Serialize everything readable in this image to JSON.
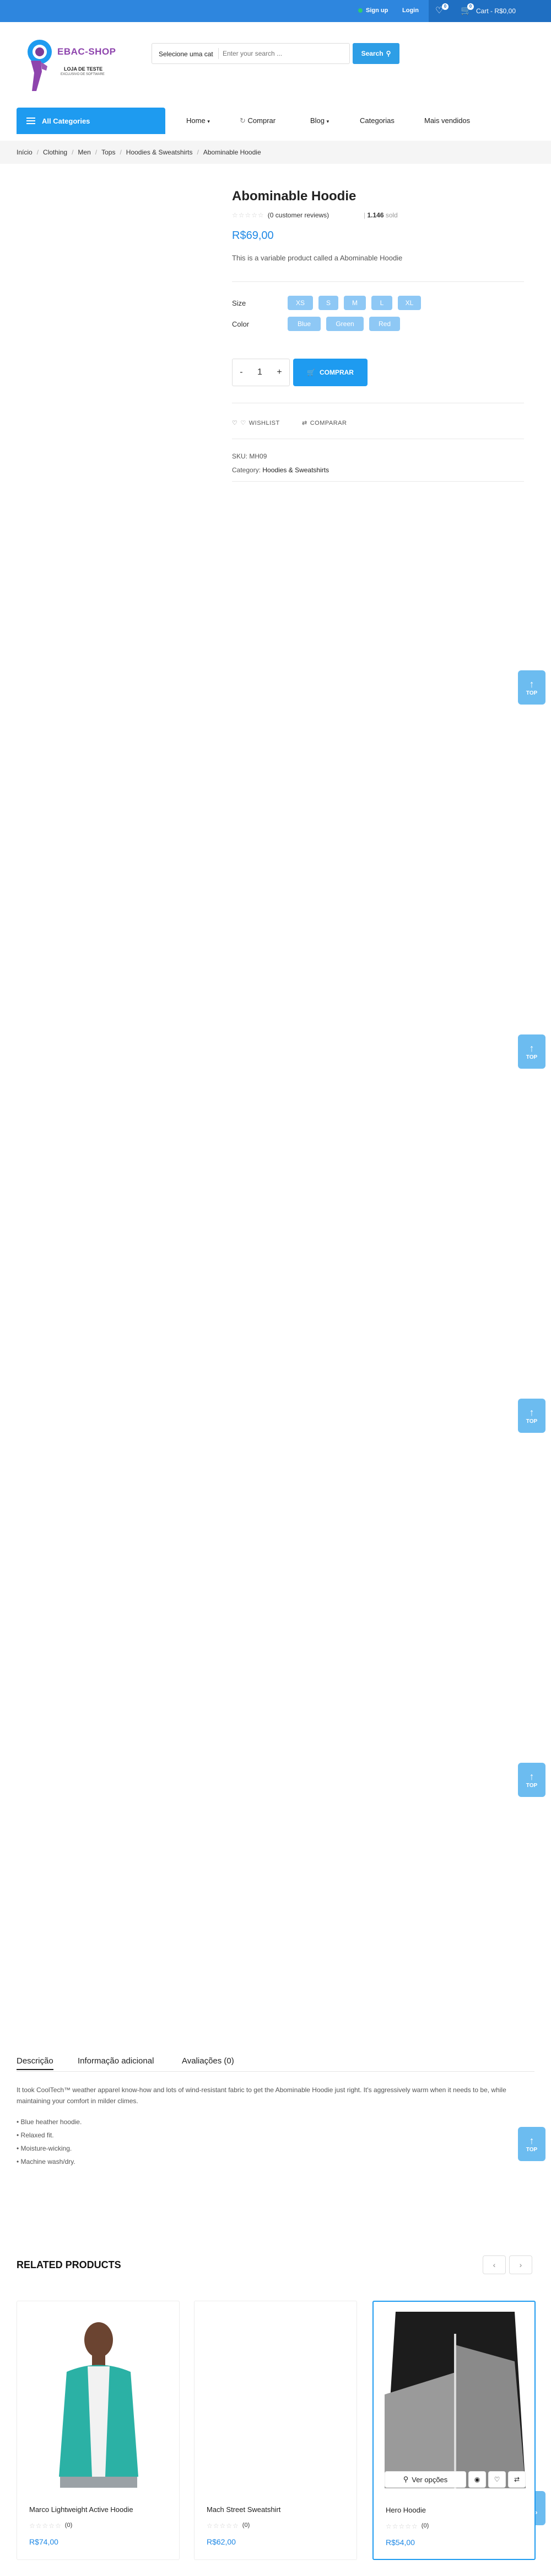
{
  "topbar": {
    "signup": "Sign up",
    "login": "Login",
    "wishlist_count": "0",
    "cart_count": "0",
    "cart_label": "Cart - R$0,00"
  },
  "logo": {
    "name": "EBAC-SHOP",
    "tagline": "LOJA DE TESTE",
    "subtagline": "EXCLUSIVO DE SOFTWARE"
  },
  "search": {
    "category": "Selecione uma cat",
    "placeholder": "Enter your search ...",
    "button": "Search"
  },
  "nav": {
    "all_categories": "All Categories",
    "items": [
      "Home",
      "Comprar",
      "Blog",
      "Categorias",
      "Mais vendidos"
    ]
  },
  "breadcrumb": [
    "Início",
    "Clothing",
    "Men",
    "Tops",
    "Hoodies & Sweatshirts",
    "Abominable Hoodie"
  ],
  "product": {
    "title": "Abominable Hoodie",
    "stars": "☆☆☆☆☆",
    "reviews": "(0 customer reviews)",
    "sold_count": "1.146",
    "sold_label": "sold",
    "price": "R$69,00",
    "short_description": "This is a variable product called a Abominable Hoodie",
    "size_label": "Size",
    "sizes": [
      "XS",
      "S",
      "M",
      "L",
      "XL"
    ],
    "color_label": "Color",
    "colors": [
      "Blue",
      "Green",
      "Red"
    ],
    "qty_minus": "-",
    "qty": "1",
    "qty_plus": "+",
    "buy": "COMPRAR",
    "wishlist": "WISHLIST",
    "compare": "COMPARAR",
    "sku_label": "SKU:",
    "sku": "MH09",
    "category_label": "Category:",
    "category": "Hoodies & Sweatshirts"
  },
  "totop_label": "TOP",
  "tabs": [
    "Descrição",
    "Informação adicional",
    "Avaliações (0)"
  ],
  "description": {
    "intro": "It took CoolTech™ weather apparel know-how and lots of wind-resistant fabric to get the Abominable Hoodie just right. It's aggressively warm when it needs to be, while maintaining your comfort in milder climes.",
    "bullets": [
      "• Blue heather hoodie.",
      "• Relaxed fit.",
      "• Moisture-wicking.",
      "• Machine wash/dry."
    ]
  },
  "related": {
    "heading": "RELATED PRODUCTS",
    "prev": "‹",
    "next": "›",
    "quick_view": "Ver opções",
    "products": [
      {
        "name": "Marco Lightweight Active Hoodie",
        "stars": "☆☆☆☆☆",
        "count": "(0)",
        "price": "R$74,00"
      },
      {
        "name": "Mach Street Sweatshirt",
        "stars": "☆☆☆☆☆",
        "count": "(0)",
        "price": "R$62,00"
      },
      {
        "name": "Hero Hoodie",
        "stars": "☆☆☆☆☆",
        "count": "(0)",
        "price": "R$54,00"
      }
    ]
  }
}
